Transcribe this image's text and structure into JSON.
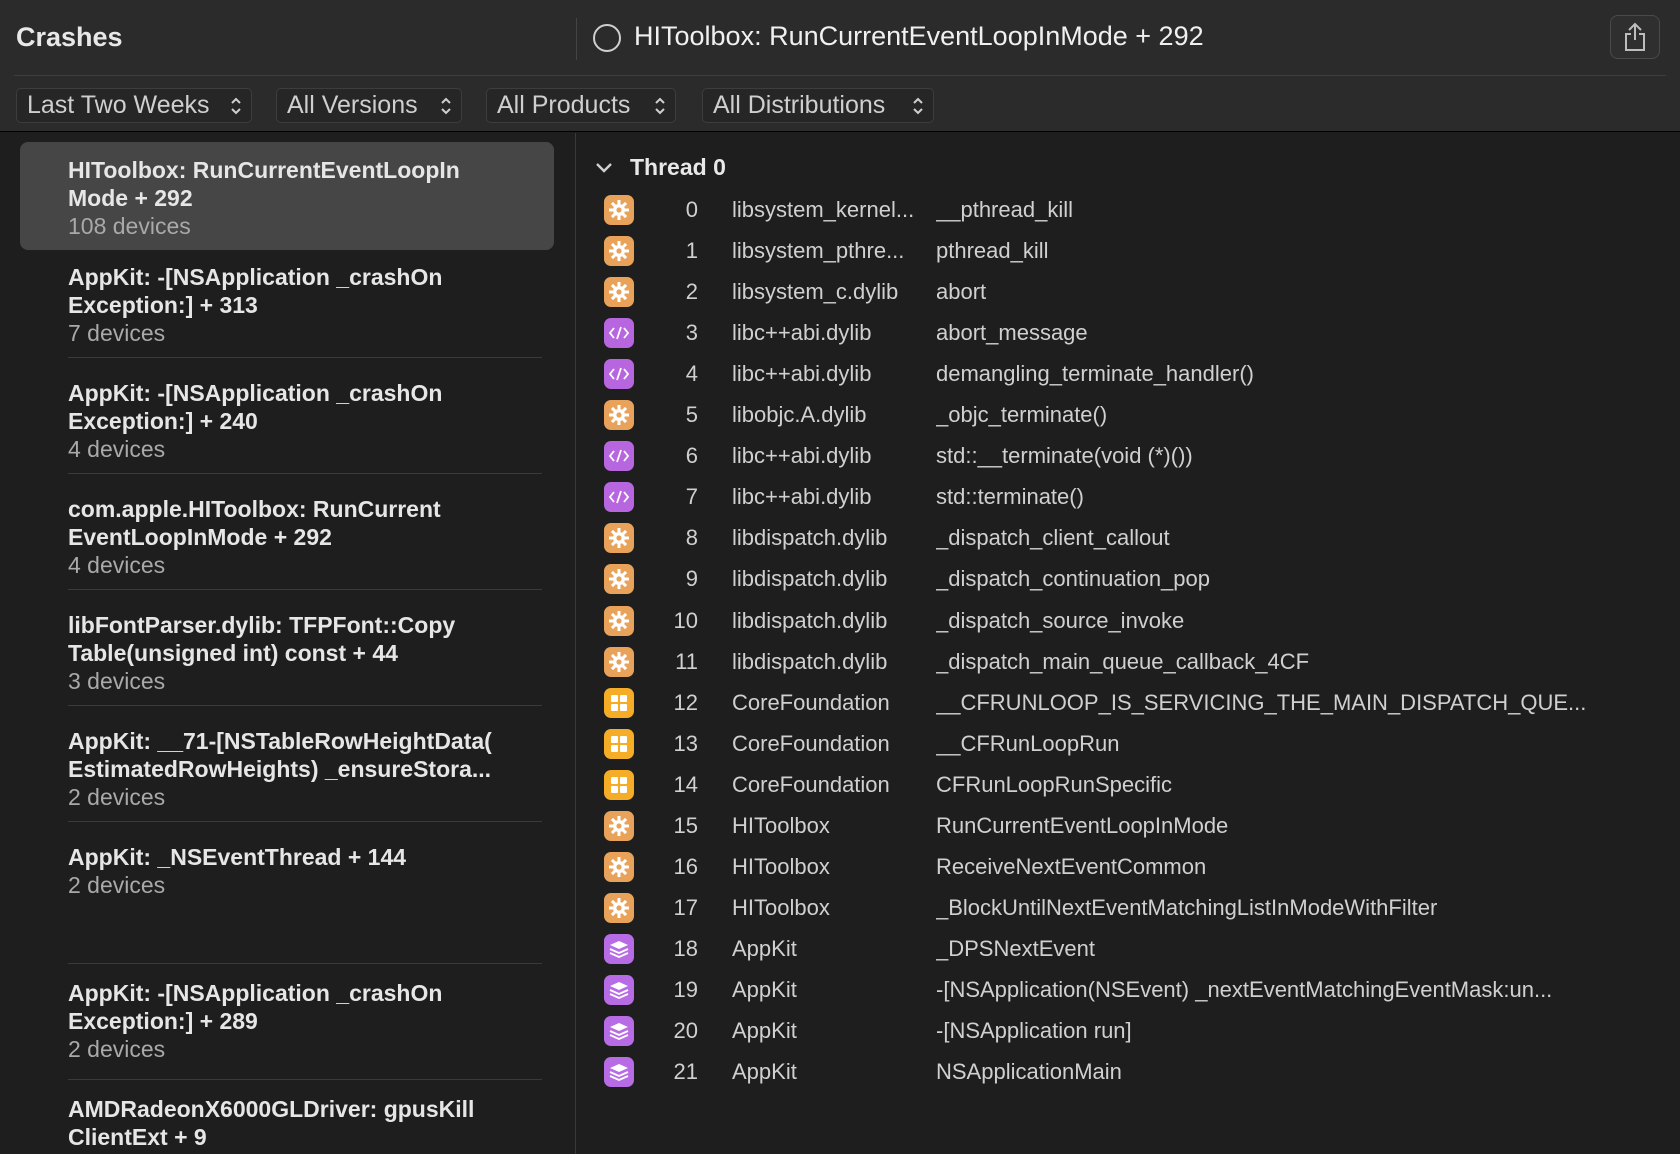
{
  "header": {
    "title": "Crashes",
    "crash_title": "HIToolbox: RunCurrentEventLoopInMode + 292"
  },
  "filters": [
    {
      "label": "Last Two Weeks"
    },
    {
      "label": "All Versions"
    },
    {
      "label": "All Products"
    },
    {
      "label": "All Distributions"
    }
  ],
  "crashes": [
    {
      "title": "HIToolbox: RunCurrentEventLoopIn\nMode + 292",
      "devices": "108 devices",
      "selected": true
    },
    {
      "title": "AppKit: -[NSApplication _crashOn\nException:] + 313",
      "devices": "7 devices"
    },
    {
      "title": "AppKit: -[NSApplication _crashOn\nException:] + 240",
      "devices": "4 devices"
    },
    {
      "title": "com.apple.HIToolbox: RunCurrent\nEventLoopInMode + 292",
      "devices": "4 devices"
    },
    {
      "title": "libFontParser.dylib: TFPFont::Copy\nTable(unsigned int) const + 44",
      "devices": "3 devices"
    },
    {
      "title": "AppKit: __71-[NSTableRowHeightData(\nEstimatedRowHeights) _ensureStora...",
      "devices": "2 devices"
    },
    {
      "title": "AppKit: _NSEventThread + 144",
      "devices": "2 devices"
    },
    {
      "title": "AppKit: -[NSApplication _crashOn\nException:] + 289",
      "devices": "2 devices"
    },
    {
      "title": "AMDRadeonX6000GLDriver: gpusKill\nClientExt + 9",
      "devices": ""
    }
  ],
  "thread": {
    "label": "Thread 0",
    "frames": [
      {
        "num": "0",
        "lib": "libsystem_kernel...",
        "sym": "__pthread_kill",
        "icon": "gear-icon"
      },
      {
        "num": "1",
        "lib": "libsystem_pthre...",
        "sym": "pthread_kill",
        "icon": "gear-icon"
      },
      {
        "num": "2",
        "lib": "libsystem_c.dylib",
        "sym": "abort",
        "icon": "gear-icon"
      },
      {
        "num": "3",
        "lib": "libc++abi.dylib",
        "sym": "abort_message",
        "icon": "code-icon"
      },
      {
        "num": "4",
        "lib": "libc++abi.dylib",
        "sym": "demangling_terminate_handler()",
        "icon": "code-icon"
      },
      {
        "num": "5",
        "lib": "libobjc.A.dylib",
        "sym": "_objc_terminate()",
        "icon": "gear-icon"
      },
      {
        "num": "6",
        "lib": "libc++abi.dylib",
        "sym": "std::__terminate(void (*)())",
        "icon": "code-icon"
      },
      {
        "num": "7",
        "lib": "libc++abi.dylib",
        "sym": "std::terminate()",
        "icon": "code-icon"
      },
      {
        "num": "8",
        "lib": "libdispatch.dylib",
        "sym": "_dispatch_client_callout",
        "icon": "gear-icon"
      },
      {
        "num": "9",
        "lib": "libdispatch.dylib",
        "sym": "_dispatch_continuation_pop",
        "icon": "gear-icon"
      },
      {
        "num": "10",
        "lib": "libdispatch.dylib",
        "sym": "_dispatch_source_invoke",
        "icon": "gear-icon"
      },
      {
        "num": "11",
        "lib": "libdispatch.dylib",
        "sym": "_dispatch_main_queue_callback_4CF",
        "icon": "gear-icon"
      },
      {
        "num": "12",
        "lib": "CoreFoundation",
        "sym": "__CFRUNLOOP_IS_SERVICING_THE_MAIN_DISPATCH_QUE...",
        "icon": "puzzle-icon"
      },
      {
        "num": "13",
        "lib": "CoreFoundation",
        "sym": "__CFRunLoopRun",
        "icon": "puzzle-icon"
      },
      {
        "num": "14",
        "lib": "CoreFoundation",
        "sym": "CFRunLoopRunSpecific",
        "icon": "puzzle-icon"
      },
      {
        "num": "15",
        "lib": "HIToolbox",
        "sym": "RunCurrentEventLoopInMode",
        "icon": "gear-icon"
      },
      {
        "num": "16",
        "lib": "HIToolbox",
        "sym": "ReceiveNextEventCommon",
        "icon": "gear-icon"
      },
      {
        "num": "17",
        "lib": "HIToolbox",
        "sym": "_BlockUntilNextEventMatchingListInModeWithFilter",
        "icon": "gear-icon"
      },
      {
        "num": "18",
        "lib": "AppKit",
        "sym": "_DPSNextEvent",
        "icon": "stack-icon"
      },
      {
        "num": "19",
        "lib": "AppKit",
        "sym": "-[NSApplication(NSEvent) _nextEventMatchingEventMask:un...",
        "icon": "stack-icon"
      },
      {
        "num": "20",
        "lib": "AppKit",
        "sym": "-[NSApplication run]",
        "icon": "stack-icon"
      },
      {
        "num": "21",
        "lib": "AppKit",
        "sym": "NSApplicationMain",
        "icon": "stack-icon"
      }
    ]
  },
  "colors": {
    "background": "#1e1e1e",
    "toolbar": "#2b2b2b",
    "selected_row": "#464646",
    "gear_icon": "#e8a25a",
    "code_icon": "#b866e0",
    "puzzle_icon": "#f5ad28",
    "stack_icon": "#b76ce6"
  }
}
